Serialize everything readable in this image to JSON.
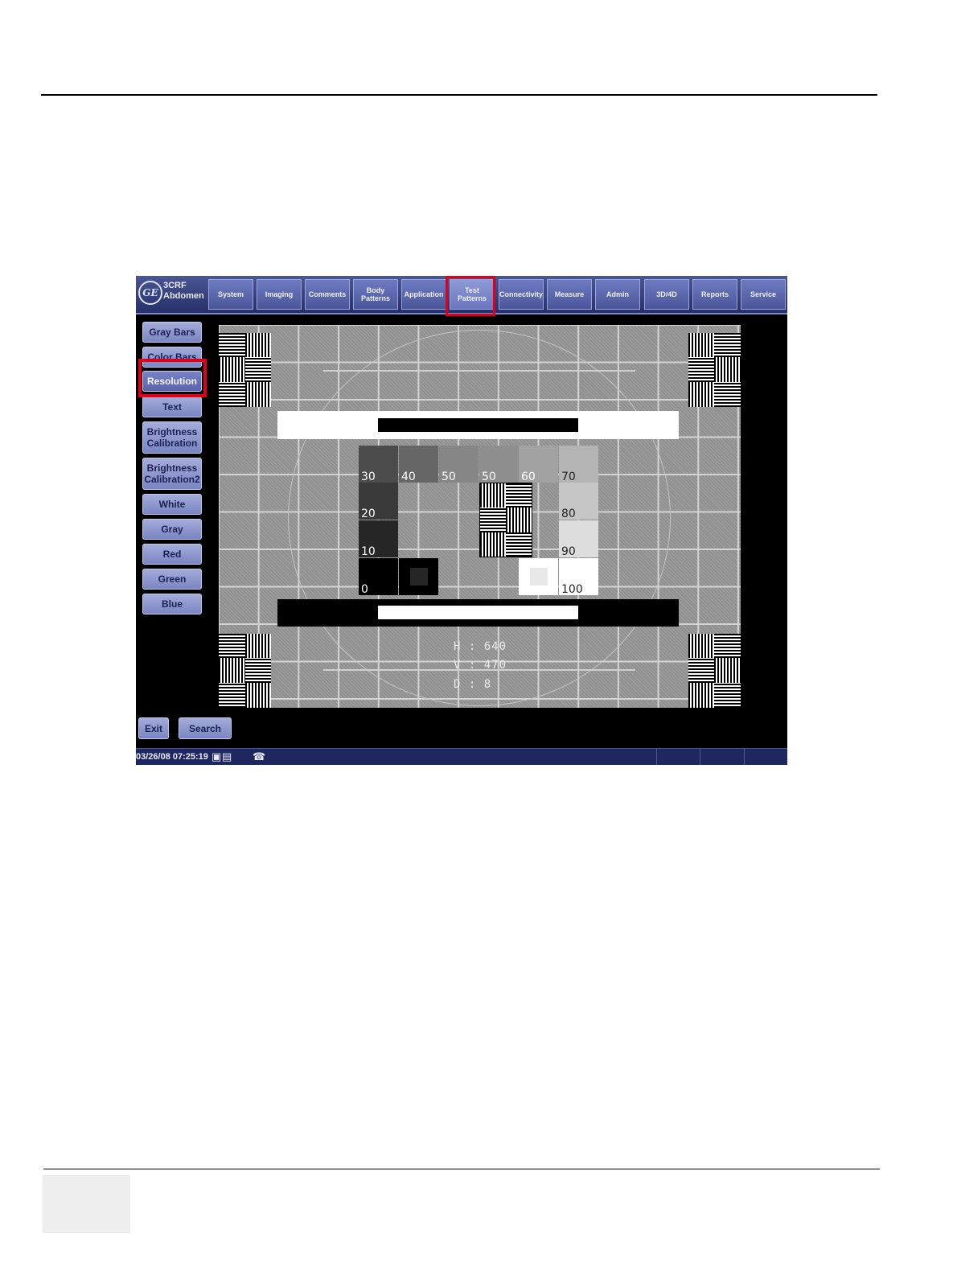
{
  "header": {
    "probe_name": "3CRF",
    "preset_name": "Abdomen"
  },
  "tabs": [
    {
      "label": "System"
    },
    {
      "label": "Imaging"
    },
    {
      "label": "Comments"
    },
    {
      "label": "Body Patterns"
    },
    {
      "label": "Application"
    },
    {
      "label": "Test Patterns",
      "active": true
    },
    {
      "label": "Connectivity"
    },
    {
      "label": "Measure"
    },
    {
      "label": "Admin"
    },
    {
      "label": "3D/4D"
    },
    {
      "label": "Reports"
    },
    {
      "label": "Service"
    }
  ],
  "sidebar": {
    "items": [
      {
        "label": "Gray Bars"
      },
      {
        "label": "Color Bars"
      },
      {
        "label": "Resolution",
        "selected": true
      },
      {
        "label": "Text"
      },
      {
        "label": "Brightness Calibration"
      },
      {
        "label": "Brightness Calibration2"
      },
      {
        "label": "White"
      },
      {
        "label": "Gray"
      },
      {
        "label": "Red"
      },
      {
        "label": "Green"
      },
      {
        "label": "Blue"
      }
    ]
  },
  "bottom_buttons": {
    "exit_label": "Exit",
    "search_label": "Search"
  },
  "status": {
    "datetime": "03/26/08 07:25:19",
    "icons": [
      "lock-icon",
      "network-icon",
      "phone-icon"
    ]
  },
  "pattern": {
    "gray_levels": [
      "30",
      "40",
      "50",
      "50",
      "60",
      "70",
      "20",
      "80",
      "10",
      "90",
      "0",
      "100"
    ],
    "info": {
      "h": "H : 640",
      "v": "V : 470",
      "d": "D : 8"
    }
  },
  "colors": {
    "highlight": "#e0001b",
    "bar_top": "#4a5794",
    "button": "#a3acd9",
    "status_bar": "#1e2760"
  }
}
